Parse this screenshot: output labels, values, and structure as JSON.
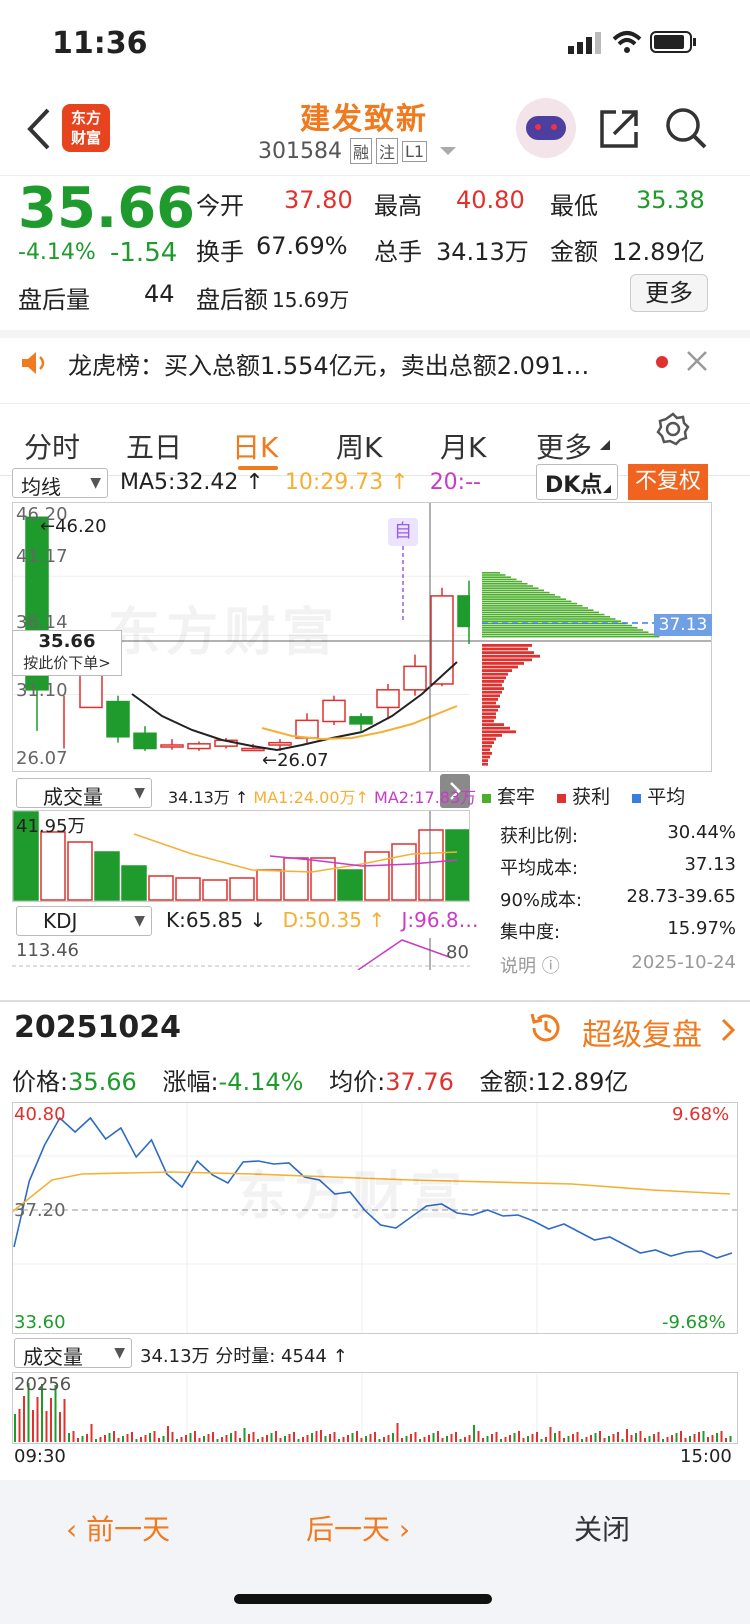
{
  "status": {
    "time": "11:36"
  },
  "header": {
    "logo_text_1": "东方",
    "logo_text_2": "财富",
    "stock_name": "建发致新",
    "stock_code": "301584",
    "badges": [
      "融",
      "注",
      "L1"
    ]
  },
  "quote": {
    "price": "35.66",
    "change_pct": "-4.14%",
    "change": "-1.54",
    "after_hours_vol_label": "盘后量",
    "after_hours_vol": "44",
    "after_hours_amt_label": "盘后额",
    "after_hours_amt": "15.69万",
    "open_label": "今开",
    "open": "37.80",
    "high_label": "最高",
    "high": "40.80",
    "low_label": "最低",
    "low": "35.38",
    "turnover_label": "换手",
    "turnover": "67.69%",
    "volume_label": "总手",
    "volume": "34.13万",
    "amount_label": "金额",
    "amount": "12.89亿",
    "more_label": "更多"
  },
  "notice": {
    "text": "龙虎榜：买入总额1.554亿元，卖出总额2.091…"
  },
  "tabs": [
    "分时",
    "五日",
    "日K",
    "周K",
    "月K",
    "更多"
  ],
  "kline": {
    "ma_select": "均线",
    "ma5": "MA5:32.42",
    "ma10": "10:29.73",
    "ma20": "20:--",
    "dk_label": "DK点",
    "fq_label": "不复权",
    "y_labels": [
      "46.20",
      "41.17",
      "36.14",
      "31.10",
      "26.07"
    ],
    "max_label": "←46.20",
    "min_label": "←26.07",
    "cross_price": "35.66",
    "cross_hint": "按此价下单>",
    "self_tag": "自",
    "watermark": "东方财富",
    "chip_price": "37.13",
    "vol_select": "成交量",
    "vol_total": "34.13万",
    "vol_ma1": "MA1:24.00万",
    "vol_ma2": "MA2:17.83万",
    "vol_max": "41.95万",
    "kdj_select": "KDJ",
    "k": "K:65.85",
    "d": "D:50.35",
    "j": "J:96.8…",
    "kdj_top": "113.46",
    "kdj_80": "80"
  },
  "chips": {
    "legend": [
      "套牢",
      "获利",
      "平均"
    ],
    "rows": [
      {
        "label": "获利比例:",
        "value": "30.44%"
      },
      {
        "label": "平均成本:",
        "value": "37.13"
      },
      {
        "label": "90%成本:",
        "value": "28.73-39.65"
      },
      {
        "label": "集中度:",
        "value": "15.97%"
      }
    ],
    "note_label": "说明",
    "date": "2025-10-24"
  },
  "review": {
    "date": "20251024",
    "title": "超级复盘",
    "price_label": "价格:",
    "price": "35.66",
    "pct_label": "涨幅:",
    "pct": "-4.14%",
    "avg_label": "均价:",
    "avg": "37.76",
    "amt_label": "金额:",
    "amt": "12.89亿",
    "y_top": "40.80",
    "y_mid": "37.20",
    "y_bot": "33.60",
    "pct_top": "9.68%",
    "pct_bot": "-9.68%",
    "vol_select": "成交量",
    "vol_info": "34.13万 分时量: 4544",
    "vol_max": "20256",
    "time_start": "09:30",
    "time_end": "15:00"
  },
  "nav": {
    "prev": "前一天",
    "next": "后一天",
    "close": "关闭"
  },
  "colors": {
    "up": "#e0312e",
    "down": "#1e9b2c",
    "accent": "#f07a1e"
  }
}
